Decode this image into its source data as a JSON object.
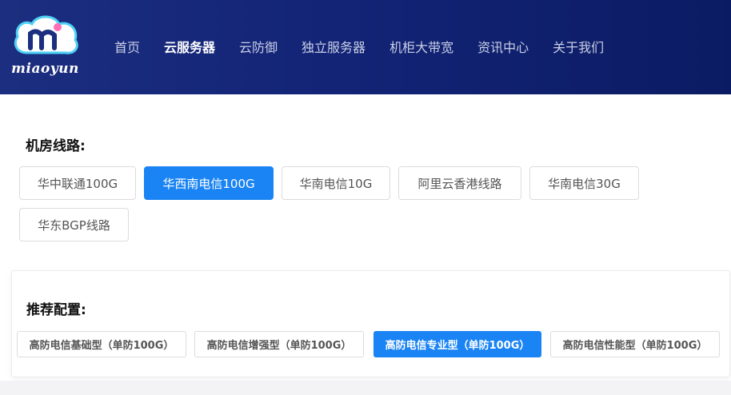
{
  "brand": {
    "name": "miaoyun",
    "icon": "cloud-m-logo-icon"
  },
  "nav": {
    "items": [
      "首页",
      "云服务器",
      "云防御",
      "独立服务器",
      "机柜大带宽",
      "资讯中心",
      "关于我们"
    ],
    "active_index": 1
  },
  "lines": {
    "title": "机房线路:",
    "options": [
      "华中联通100G",
      "华西南电信100G",
      "华南电信10G",
      "阿里云香港线路",
      "华南电信30G",
      "华东BGP线路"
    ],
    "selected_index": 1
  },
  "config": {
    "title": "推荐配置:",
    "options": [
      "高防电信基础型（单防100G）",
      "高防电信增强型（单防100G）",
      "高防电信专业型（单防100G）",
      "高防电信性能型（单防100G）"
    ],
    "selected_index": 2
  },
  "colors": {
    "header_bg": "#132477",
    "accent": "#1a84f4"
  }
}
